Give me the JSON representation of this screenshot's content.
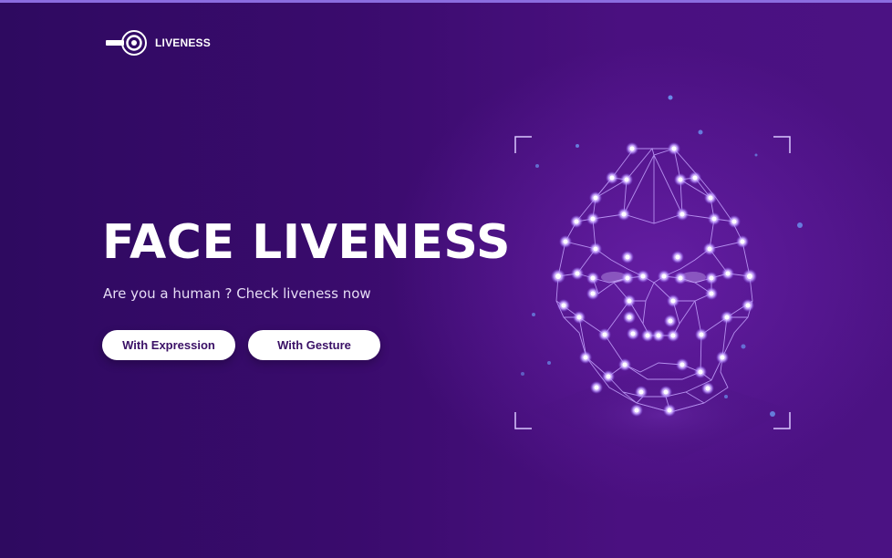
{
  "brand": {
    "name": "LIVENESS",
    "logo_icon": "liveness-logo-icon"
  },
  "hero": {
    "title": "FACE LIVENESS",
    "subtitle": "Are you a human ? Check liveness now"
  },
  "actions": {
    "expression_label": "With Expression",
    "gesture_label": "With Gesture"
  },
  "illustration": {
    "icon": "face-mesh-illustration",
    "accent_color": "#b48cff",
    "node_color": "#ffffff"
  },
  "colors": {
    "background_dark": "#2e0a60",
    "background_light": "#4b1283",
    "button_text": "#3a1066",
    "accent_line": "#8b6de0"
  }
}
